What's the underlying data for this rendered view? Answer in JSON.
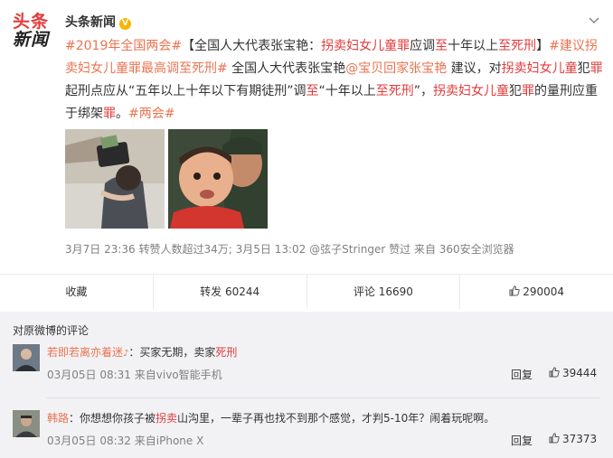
{
  "post": {
    "author": "头条新闻",
    "logo_line1": "头条",
    "logo_line2": "新闻",
    "text": {
      "t1": "#2019年全国两会#",
      "t2": "【全国人大代表张宝艳：",
      "t3": "拐卖妇女儿童罪",
      "t4": "应调",
      "t5": "至",
      "t6": "十年以上",
      "t7": "至死刑",
      "t8": "】",
      "t9": "#建议拐卖妇女儿童罪最高调至死刑#",
      "t10": " 全国人大代表张宝艳",
      "t11": "@宝贝回家张宝艳",
      "t12": " 建议，对",
      "t13": "拐卖妇女儿童",
      "t14": "犯",
      "t15": "罪",
      "t16": "起刑点应从“五年以上十年以下有期徒刑”调",
      "t17": "至",
      "t18": "“十年以上",
      "t19": "至死刑",
      "t20": "”，",
      "t21": "拐卖妇女儿童",
      "t22": "犯",
      "t23": "罪",
      "t24": "的量刑应重于绑架",
      "t25": "罪",
      "t26": "。",
      "t27": "#两会#"
    },
    "meta": {
      "time": "3月7日 23:36",
      "repost_info": "转赞人数超过34万; 3月5日 13:02",
      "via": "@弦子Stringer",
      "liked": "赞过",
      "source": "来自 360安全浏览器"
    }
  },
  "actions": {
    "favorite": "收藏",
    "repost": "转发 60244",
    "comment": "评论 16690",
    "like": "290004"
  },
  "comments_header": "对原微博的评论",
  "comments": [
    {
      "name": "若即若离亦着迷",
      "badge": "♪",
      "text_prefix": "：买家无期，卖家",
      "text_hl": "死刑",
      "time": "03月05日 08:31",
      "source": "来自vivo智能手机",
      "reply": "回复",
      "likes": "39444"
    },
    {
      "name": "韩路",
      "text_prefix": "：你想想你孩子被",
      "text_hl": "拐卖",
      "text_suffix": "山沟里，一辈子再也找不到那个感觉，才判5-10年？闹着玩呢啊。",
      "time": "03月05日 08:32",
      "source": "来自iPhone X",
      "reply": "回复",
      "likes": "37373"
    }
  ],
  "colors": {
    "accent": "#eb7350",
    "highlight": "#e23b3b",
    "verified": "#f7b500",
    "muted": "#808080"
  }
}
